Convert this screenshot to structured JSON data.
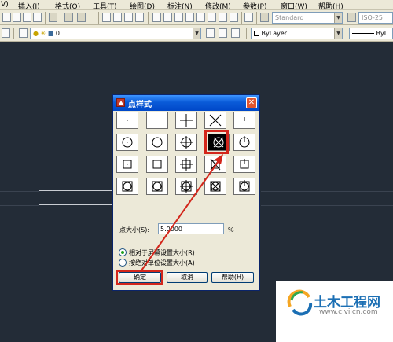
{
  "menu": {
    "items": [
      "V)",
      "插入(I)",
      "格式(O)",
      "工具(T)",
      "绘图(D)",
      "标注(N)",
      "修改(M)",
      "参数(P)",
      "窗口(W)",
      "帮助(H)"
    ]
  },
  "toolbar1": {
    "text_style": "Standard",
    "dim_style": "ISO-25"
  },
  "toolbar2": {
    "layer_value": "0",
    "color_value": "ByLayer",
    "linetype_value": "ByL"
  },
  "colors": {
    "canvas": "#232c37",
    "dialog_bg": "#ece9d8",
    "titlebar": "#0a5bd8",
    "highlight": "#d3261b",
    "guide_line": "#c8ccd2"
  },
  "dialog": {
    "title": "点样式",
    "close_icon": "close-icon",
    "selected_style_index": 13,
    "size_label": "点大小(S):",
    "size_value": "5.0000",
    "size_unit": "%",
    "radio_relative": "相对于屏幕设置大小(R)",
    "radio_absolute": "按绝对单位设置大小(A)",
    "relative_selected": true,
    "ok_label": "确定",
    "cancel_label": "取消",
    "help_label": "帮助(H)"
  },
  "watermark": {
    "name": "土木工程网",
    "url": "www.civilcn.com"
  }
}
